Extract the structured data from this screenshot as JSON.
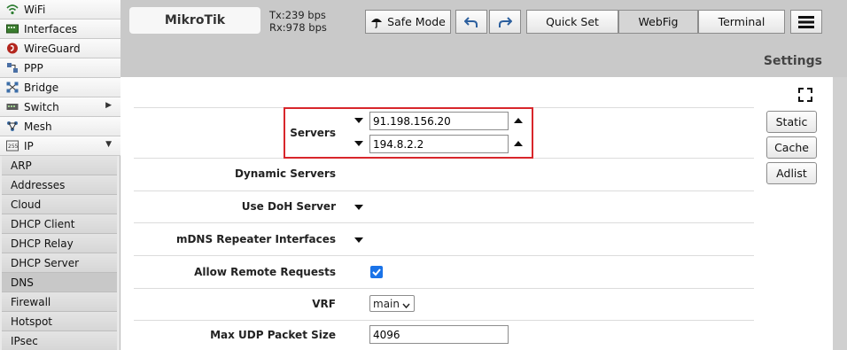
{
  "sidebar": {
    "items": [
      {
        "label": "WiFi",
        "icon": "wifi-icon"
      },
      {
        "label": "Interfaces",
        "icon": "interfaces-icon"
      },
      {
        "label": "WireGuard",
        "icon": "wireguard-icon"
      },
      {
        "label": "PPP",
        "icon": "ppp-icon"
      },
      {
        "label": "Bridge",
        "icon": "bridge-icon"
      },
      {
        "label": "Switch",
        "icon": "switch-icon",
        "arrow": "▶"
      },
      {
        "label": "Mesh",
        "icon": "mesh-icon"
      },
      {
        "label": "IP",
        "icon": "ip-icon",
        "arrow": "▼"
      }
    ],
    "subitems": [
      {
        "label": "ARP"
      },
      {
        "label": "Addresses"
      },
      {
        "label": "Cloud"
      },
      {
        "label": "DHCP Client"
      },
      {
        "label": "DHCP Relay"
      },
      {
        "label": "DHCP Server"
      },
      {
        "label": "DNS",
        "active": true
      },
      {
        "label": "Firewall"
      },
      {
        "label": "Hotspot"
      },
      {
        "label": "IPsec"
      }
    ]
  },
  "header": {
    "logo": "MikroTik",
    "tx": "Tx:239 bps",
    "rx": "Rx:978 bps",
    "safe_mode": "Safe Mode",
    "quick_set": "Quick Set",
    "webfig": "WebFig",
    "terminal": "Terminal",
    "settings": "Settings"
  },
  "form": {
    "servers_label": "Servers",
    "servers": [
      "91.198.156.20",
      "194.8.2.2"
    ],
    "dynamic_servers_label": "Dynamic Servers",
    "use_doh_label": "Use DoH Server",
    "mdns_label": "mDNS Repeater Interfaces",
    "allow_remote_label": "Allow Remote Requests",
    "allow_remote_checked": true,
    "vrf_label": "VRF",
    "vrf_value": "main",
    "max_udp_label": "Max UDP Packet Size",
    "max_udp_value": "4096"
  },
  "side_buttons": {
    "static": "Static",
    "cache": "Cache",
    "adlist": "Adlist"
  },
  "colors": {
    "highlight_border": "#d8262b",
    "checkbox_blue": "#1a73e8"
  }
}
